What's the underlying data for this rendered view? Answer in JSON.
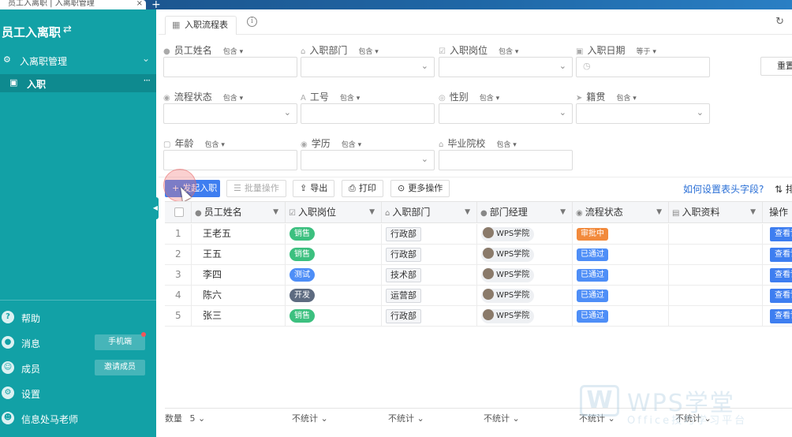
{
  "browser": {
    "tab_title": "员工入离职 | 入离职管理",
    "close": "×",
    "plus": "+"
  },
  "sidebar": {
    "app_title": "员工入离职",
    "group_label": "入离职管理",
    "active_item": "入职",
    "help": "帮助",
    "messages": "消息",
    "messages_pill": "手机端",
    "members": "成员",
    "members_pill": "邀请成员",
    "settings": "设置",
    "user": "信息处马老师"
  },
  "tabbar": {
    "view_tab": "入职流程表"
  },
  "filters": {
    "name": {
      "label": "员工姓名",
      "op": "包含 ▾"
    },
    "dept": {
      "label": "入职部门",
      "op": "包含 ▾"
    },
    "position": {
      "label": "入职岗位",
      "op": "包含 ▾"
    },
    "date": {
      "label": "入职日期",
      "op": "等于 ▾"
    },
    "status": {
      "label": "流程状态",
      "op": "包含 ▾"
    },
    "emp_no": {
      "label": "工号",
      "op": "包含 ▾"
    },
    "gender": {
      "label": "性别",
      "op": "包含 ▾"
    },
    "origin": {
      "label": "籍贯",
      "op": "包含 ▾"
    },
    "age": {
      "label": "年龄",
      "op": "包含 ▾"
    },
    "education": {
      "label": "学历",
      "op": "包含 ▾"
    },
    "school": {
      "label": "毕业院校",
      "op": "包含 ▾"
    },
    "reset": "重置"
  },
  "toolbar": {
    "add": "发起入职",
    "batch": "批量操作",
    "export": "导出",
    "print": "打印",
    "more": "更多操作",
    "help_link": "如何设置表头字段?",
    "sort": "排"
  },
  "table": {
    "headers": [
      "员工姓名",
      "入职岗位",
      "入职部门",
      "部门经理",
      "流程状态",
      "入职资料",
      "操作"
    ],
    "rows": [
      {
        "no": "1",
        "name": "王老五",
        "position": "销售",
        "dept": "行政部",
        "manager": "WPS学院",
        "status": "审批中",
        "action": "查看详情"
      },
      {
        "no": "2",
        "name": "王五",
        "position": "销售",
        "dept": "行政部",
        "manager": "WPS学院",
        "status": "已通过",
        "action": "查看详情"
      },
      {
        "no": "3",
        "name": "李四",
        "position": "测试",
        "dept": "技术部",
        "manager": "WPS学院",
        "status": "已通过",
        "action": "查看详情"
      },
      {
        "no": "4",
        "name": "陈六",
        "position": "开发",
        "dept": "运营部",
        "manager": "WPS学院",
        "status": "已通过",
        "action": "查看详情"
      },
      {
        "no": "5",
        "name": "张三",
        "position": "销售",
        "dept": "行政部",
        "manager": "WPS学院",
        "status": "已通过",
        "action": "查看详情"
      }
    ],
    "footer": {
      "count_label": "数量",
      "count_value": "5",
      "stat": "不统计"
    }
  },
  "watermark": {
    "logo": "W",
    "text": "WPS学堂",
    "sub": "Office技巧学习平台"
  },
  "colors": {
    "sidebar": "#12a1a6",
    "primary": "#3e7ef0",
    "sales": "#3cc07f",
    "review": "#f28a3c",
    "pass": "#4e8ef7"
  }
}
